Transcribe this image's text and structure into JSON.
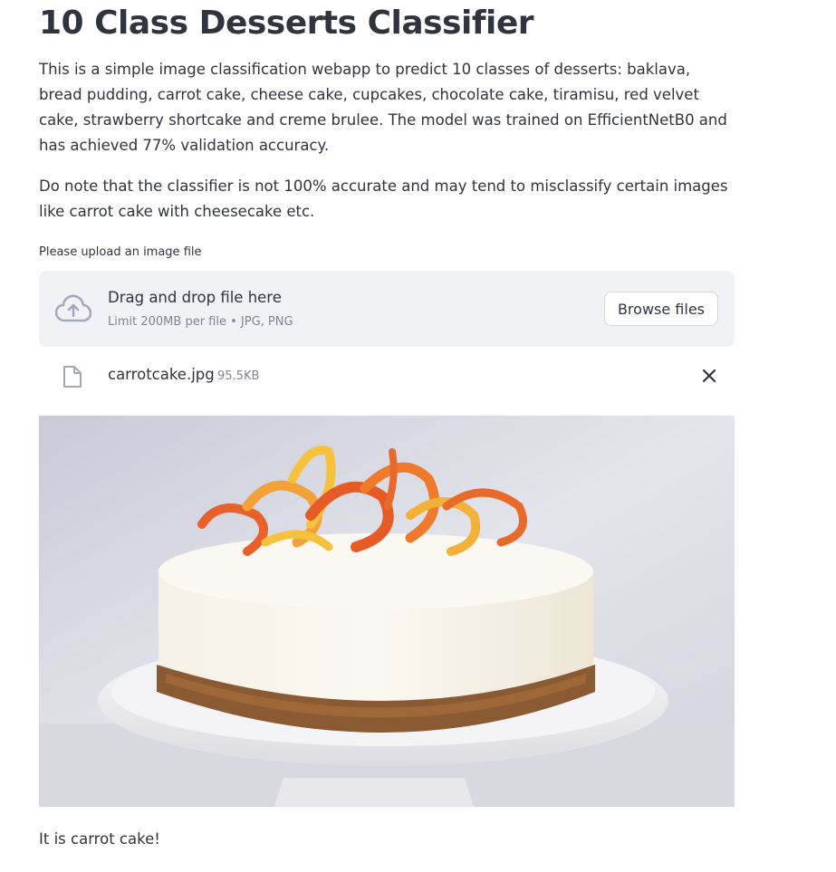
{
  "title": "10 Class Desserts Classifier",
  "intro": "This is a simple image classification webapp to predict 10 classes of desserts: baklava, bread pudding, carrot cake, cheese cake, cupcakes, chocolate cake, tiramisu, red velvet cake, strawberry shortcake and creme brulee. The model was trained on EfficientNetB0 and has achieved 77% validation accuracy.",
  "note": "Do note that the classifier is not 100% accurate and may tend to misclassify certain images like carrot cake with cheesecake etc.",
  "uploader": {
    "label": "Please upload an image file",
    "drop_text": "Drag and drop file here",
    "limit_text": "Limit 200MB per file • JPG, PNG",
    "browse_label": "Browse files"
  },
  "file": {
    "name": "carrotcake.jpg",
    "size": "95.5KB",
    "icon": "file-icon",
    "remove_icon": "close-icon"
  },
  "image": {
    "alt": "Carrot cake with carrot curls"
  },
  "result": "It is carrot cake!",
  "colors": {
    "dropzone_bg": "#f0f2f6",
    "text": "#31333f",
    "muted": "#808495"
  }
}
